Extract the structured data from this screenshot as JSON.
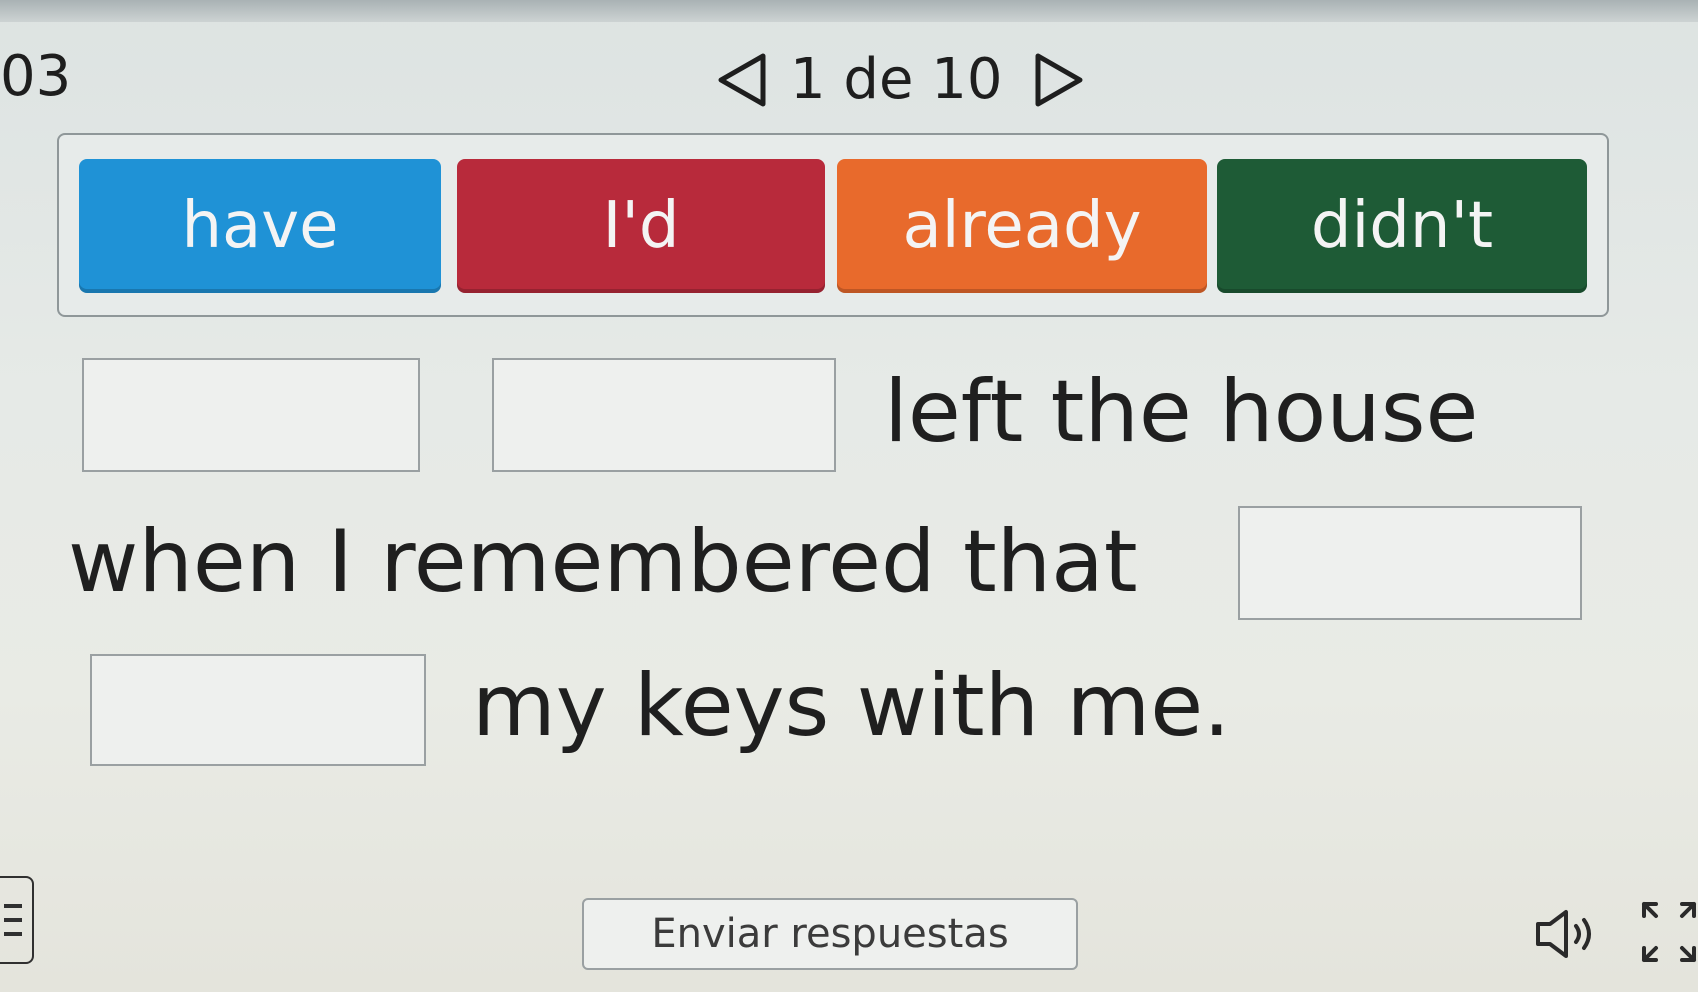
{
  "header": {
    "question_number": "03",
    "pager": {
      "text": "1 de 10",
      "prev_icon": "triangle-left-icon",
      "next_icon": "triangle-right-icon"
    }
  },
  "word_bank": [
    {
      "label": "have",
      "color": "#1f92d6"
    },
    {
      "label": "I'd",
      "color": "#b82a3b"
    },
    {
      "label": "already",
      "color": "#e86a2c"
    },
    {
      "label": "didn't",
      "color": "#1e5b36"
    }
  ],
  "sentence": {
    "fragment_1": "left the house",
    "fragment_2": "when I remembered that",
    "fragment_3": "my keys with me."
  },
  "footer": {
    "submit_label": "Enviar respuestas",
    "menu_icon": "menu-icon",
    "audio_icon": "speaker-icon",
    "fullscreen_icon": "fullscreen-icon"
  }
}
